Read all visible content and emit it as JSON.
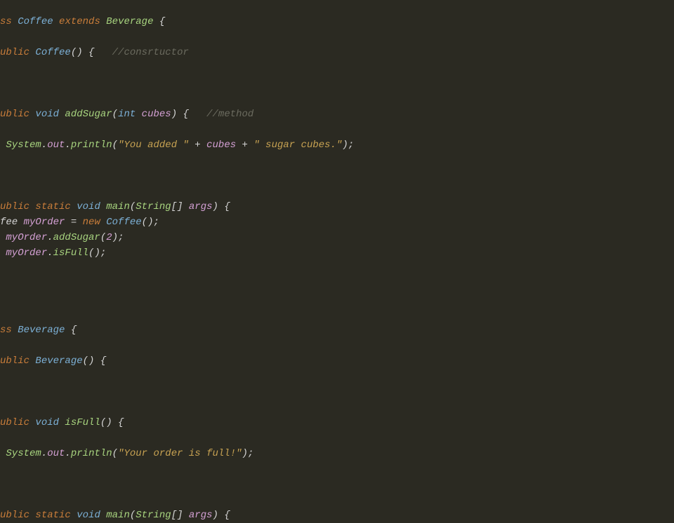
{
  "code": {
    "line1": {
      "cls": "ss ",
      "name": "Coffee",
      "ext": " extends ",
      "parent": "Beverage",
      "brace": " {"
    },
    "line3": {
      "pub": "ublic ",
      "name": "Coffee",
      "parens": "() {",
      "comment": "   //consrtuctor"
    },
    "line7": {
      "pub": "ublic ",
      "vd": "void",
      "method": " addSugar",
      "open": "(",
      "type": "int",
      "param": " cubes",
      "close": ") {",
      "comment": "   //method"
    },
    "line9": {
      "pad": " ",
      "sys": "System",
      "dot1": ".",
      "out": "out",
      "dot2": ".",
      "println": "println",
      "open": "(",
      "str1": "\"You added \"",
      "plus1": " + ",
      "var": "cubes",
      "plus2": " + ",
      "str2": "\" sugar cubes.\"",
      "close": ");"
    },
    "line13": {
      "pub": "ublic ",
      "stat": "static ",
      "vd": "void",
      "main": " main",
      "open": "(",
      "strtype": "String",
      "brackets": "[] ",
      "args": "args",
      "close": ") {"
    },
    "line14": {
      "pre": "fee ",
      "var": "myOrder",
      "eq": " = ",
      "nw": "new ",
      "cls": "Coffee",
      "end": "();"
    },
    "line15": {
      "pad": " ",
      "var": "myOrder",
      "dot": ".",
      "method": "addSugar",
      "open": "(",
      "num": "2",
      "close": ");"
    },
    "line16": {
      "pad": " ",
      "var": "myOrder",
      "dot": ".",
      "method": "isFull",
      "end": "();"
    },
    "line21": {
      "cls": "ss ",
      "name": "Beverage",
      "brace": " {"
    },
    "line23": {
      "pub": "ublic ",
      "name": "Beverage",
      "end": "() {"
    },
    "line27": {
      "pub": "ublic ",
      "vd": "void",
      "method": " isFull",
      "end": "() {"
    },
    "line29": {
      "pad": " ",
      "sys": "System",
      "dot1": ".",
      "out": "out",
      "dot2": ".",
      "println": "println",
      "open": "(",
      "str": "\"Your order is full!\"",
      "close": ");"
    },
    "line33": {
      "pub": "ublic ",
      "stat": "static ",
      "vd": "void",
      "main": " main",
      "open": "(",
      "strtype": "String",
      "brackets": "[] ",
      "args": "args",
      "close": ") {"
    }
  }
}
